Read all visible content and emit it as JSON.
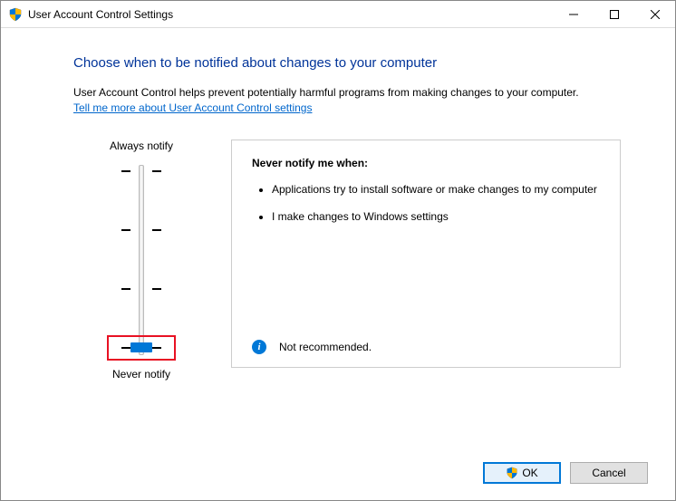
{
  "titlebar": {
    "title": "User Account Control Settings"
  },
  "heading": "Choose when to be notified about changes to your computer",
  "description": "User Account Control helps prevent potentially harmful programs from making changes to your computer.",
  "link": "Tell me more about User Account Control settings",
  "slider": {
    "top_label": "Always notify",
    "bottom_label": "Never notify"
  },
  "panel": {
    "heading": "Never notify me when:",
    "bullets": [
      "Applications try to install software or make changes to my computer",
      "I make changes to Windows settings"
    ],
    "status": "Not recommended."
  },
  "buttons": {
    "ok": "OK",
    "cancel": "Cancel"
  }
}
